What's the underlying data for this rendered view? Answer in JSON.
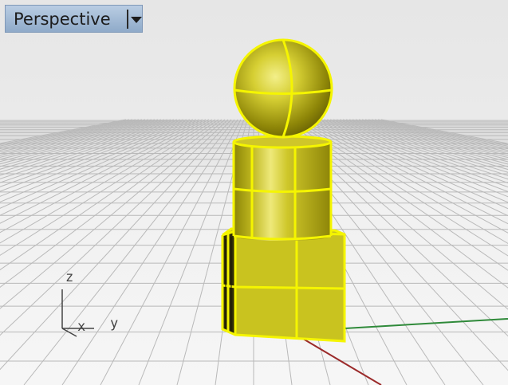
{
  "viewport": {
    "title": "Perspective",
    "dropdown_icon": "triangle-down-icon"
  },
  "axes_widget": {
    "z_label": "z",
    "x_label": "x",
    "y_label": "y"
  },
  "colors": {
    "background_top": "#eeeeee",
    "grid_floor": "#f2f2f2",
    "grid_line": "#b9b9b9",
    "selection_outline": "#f5f500",
    "object_fill": "#c8c21a",
    "world_x_axis": "#9b2a2a",
    "world_y_axis": "#2f8a3a",
    "tab_fill": "#a7bcd6"
  },
  "scene_objects": [
    "sphere",
    "cylinder",
    "box"
  ]
}
